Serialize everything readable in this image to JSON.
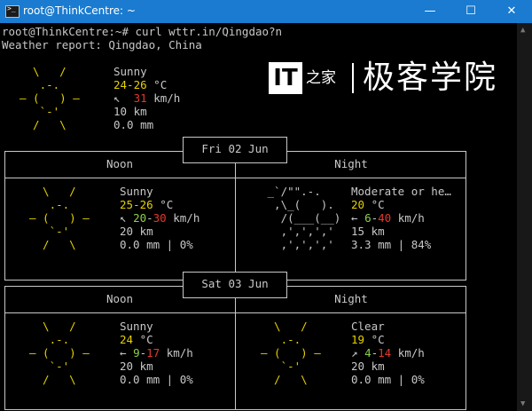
{
  "window": {
    "title": "root@ThinkCentre: ~",
    "icon_label": ">_",
    "minimize": "—",
    "maximize": "☐",
    "close": "✕"
  },
  "terminal": {
    "prompt": "root@ThinkCentre:~# curl wttr.in/Qingdao?n",
    "report_header": "Weather report: Qingdao, China",
    "current": {
      "icon": [
        "  \\   /  ",
        "   .-.   ",
        "― (   ) ―",
        "   `-'   ",
        "  /   \\  "
      ],
      "condition": "Sunny",
      "temperature": "24-26",
      "temp_unit": "°C",
      "wind_arrow": "↖",
      "wind_speed": "31",
      "wind_unit": "km/h",
      "visibility": "10 km",
      "precipitation": "0.0 mm"
    },
    "days": [
      {
        "date": "Fri 02 Jun",
        "columns": [
          {
            "heading": "Noon",
            "icon_type": "sun",
            "icon": [
              "  \\   /  ",
              "   .-.   ",
              "― (   ) ―",
              "   `-'   ",
              "  /   \\  "
            ],
            "condition": "Sunny",
            "temp_lo": "25",
            "temp_sep": "-",
            "temp_hi": "26",
            "temp_unit": "°C",
            "wind_arrow": "↖",
            "wind_lo": "20",
            "wind_sep": "-",
            "wind_hi": "30",
            "wind_unit": "km/h",
            "visibility": "20 km",
            "precip": "0.0 mm | 0%"
          },
          {
            "heading": "Night",
            "icon_type": "rain",
            "icon": [
              " _`/\"\".-.  ",
              "  ,\\_(   ). ",
              "   /(___(__)",
              "   ‚'‚'‚'‚'",
              "   ‚'‚'‚'‚' "
            ],
            "condition": "Moderate or he…",
            "temp_lo": "20",
            "temp_sep": "",
            "temp_hi": "",
            "temp_unit": "°C",
            "wind_arrow": "←",
            "wind_lo": "6",
            "wind_sep": "-",
            "wind_hi": "40",
            "wind_unit": "km/h",
            "visibility": "15 km",
            "precip": "3.3 mm | 84%"
          }
        ]
      },
      {
        "date": "Sat 03 Jun",
        "columns": [
          {
            "heading": "Noon",
            "icon_type": "sun",
            "icon": [
              "  \\   /  ",
              "   .-.   ",
              "― (   ) ―",
              "   `-'   ",
              "  /   \\  "
            ],
            "condition": "Sunny",
            "temp_lo": "24",
            "temp_sep": "",
            "temp_hi": "",
            "temp_unit": "°C",
            "wind_arrow": "←",
            "wind_lo": "9",
            "wind_sep": "-",
            "wind_hi": "17",
            "wind_unit": "km/h",
            "visibility": "20 km",
            "precip": "0.0 mm | 0%"
          },
          {
            "heading": "Night",
            "icon_type": "sun",
            "icon": [
              "  \\   /  ",
              "   .-.   ",
              "― (   ) ―",
              "   `-'   ",
              "  /   \\  "
            ],
            "condition": "Clear",
            "temp_lo": "19",
            "temp_sep": "",
            "temp_hi": "",
            "temp_unit": "°C",
            "wind_arrow": "↗",
            "wind_lo": "4",
            "wind_sep": "-",
            "wind_hi": "14",
            "wind_unit": "km/h",
            "visibility": "20 km",
            "precip": "0.0 mm | 0%"
          }
        ]
      }
    ]
  },
  "watermark": {
    "it_mark": "IT",
    "mark_char": "之家",
    "brand": "极客学院"
  },
  "colors": {
    "titlebar": "#1a7bd0",
    "background": "#000000",
    "text": "#c8c8c8",
    "sun": "#e6d100",
    "wind_high": "#e23a2b",
    "wind_low": "#8cd04a"
  }
}
